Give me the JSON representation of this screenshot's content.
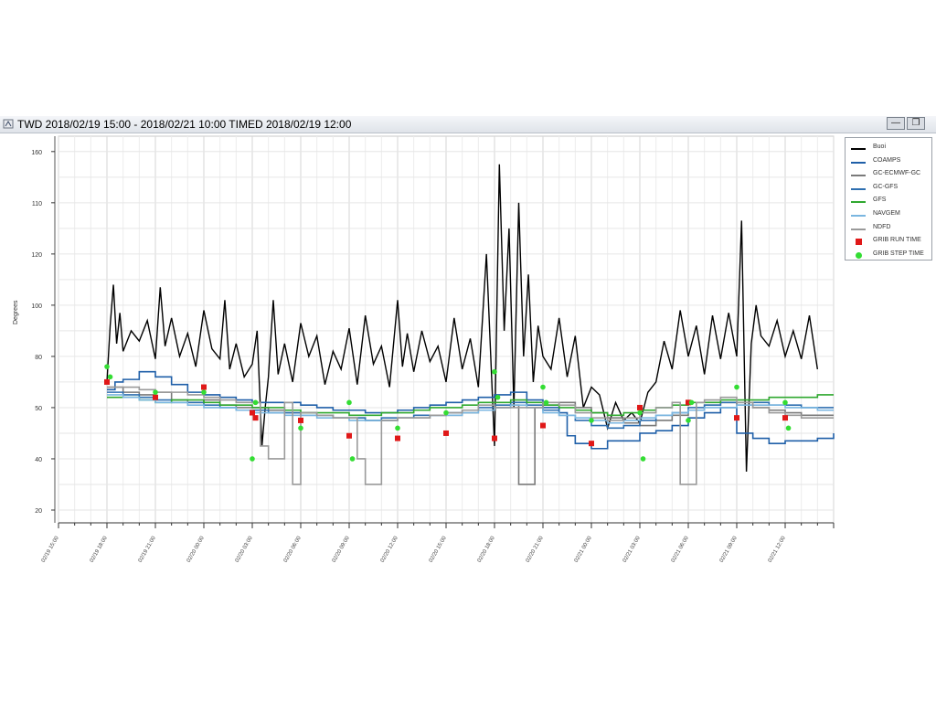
{
  "window": {
    "title": "TWD 2018/02/19 15:00 - 2018/02/21 10:00 TIMED 2018/02/19 12:00",
    "icon": "java-app-icon",
    "min_label": "—",
    "max_label": "❐"
  },
  "chart_data": {
    "type": "line",
    "ylabel": "Degrees",
    "ylim": [
      15,
      166
    ],
    "y_ticks": [
      20,
      40,
      60,
      80,
      100,
      120,
      140,
      160
    ],
    "y_tick_labels": [
      "20",
      "40",
      "50",
      "80",
      "100",
      "120",
      "110",
      "160"
    ],
    "x_tick_labels": [
      "02/19 15:00",
      "02/19 18:00",
      "02/19 21:00",
      "02/20 00:00",
      "02/20 03:00",
      "02/20 06:00",
      "02/20 09:00",
      "02/20 12:00",
      "02/20 15:00",
      "02/20 18:00",
      "02/20 21:00",
      "02/21 00:00",
      "02/21 03:00",
      "02/21 06:00",
      "02/21 09:00",
      "02/21 12:00"
    ],
    "x_range_hours": [
      0,
      48
    ],
    "series": [
      {
        "name": "Buoi",
        "color": "#000000",
        "style": "line",
        "x": [
          3.0,
          3.2,
          3.4,
          3.6,
          3.8,
          4.0,
          4.5,
          5.0,
          5.5,
          6.0,
          6.3,
          6.6,
          7.0,
          7.5,
          8.0,
          8.5,
          9.0,
          9.5,
          10.0,
          10.3,
          10.6,
          11.0,
          11.5,
          12.0,
          12.3,
          12.6,
          12.8,
          13.0,
          13.3,
          13.6,
          14.0,
          14.5,
          15.0,
          15.5,
          16.0,
          16.5,
          17.0,
          17.5,
          18.0,
          18.5,
          19.0,
          19.5,
          20.0,
          20.5,
          21.0,
          21.3,
          21.6,
          22.0,
          22.5,
          23.0,
          23.5,
          24.0,
          24.5,
          25.0,
          25.5,
          26.0,
          26.5,
          27.0,
          27.3,
          27.6,
          27.9,
          28.2,
          28.5,
          28.8,
          29.1,
          29.4,
          29.7,
          30.0,
          30.5,
          31.0,
          31.5,
          32.0,
          32.5,
          33.0,
          33.5,
          34.0,
          34.5,
          35.0,
          35.5,
          36.0,
          36.5,
          37.0,
          37.5,
          38.0,
          38.5,
          39.0,
          39.5,
          40.0,
          40.5,
          41.0,
          41.5,
          42.0,
          42.3,
          42.6,
          42.9,
          43.2,
          43.5,
          44.0,
          44.5,
          45.0,
          45.5,
          46.0,
          46.5,
          47.0
        ],
        "values": [
          70,
          92,
          108,
          85,
          97,
          82,
          90,
          86,
          94,
          79,
          107,
          84,
          95,
          80,
          89,
          76,
          98,
          83,
          79,
          102,
          75,
          85,
          72,
          77,
          90,
          45,
          60,
          72,
          102,
          73,
          85,
          70,
          93,
          80,
          88,
          69,
          82,
          75,
          91,
          69,
          96,
          77,
          84,
          68,
          102,
          76,
          89,
          74,
          90,
          78,
          84,
          70,
          95,
          75,
          87,
          68,
          120,
          45,
          155,
          90,
          130,
          60,
          140,
          80,
          112,
          70,
          92,
          80,
          75,
          95,
          72,
          88,
          60,
          68,
          65,
          52,
          62,
          55,
          58,
          54,
          66,
          70,
          86,
          75,
          98,
          80,
          92,
          73,
          96,
          79,
          97,
          80,
          133,
          35,
          85,
          100,
          88,
          84,
          94,
          80,
          90,
          79,
          96,
          75
        ]
      },
      {
        "name": "COAMPS",
        "color": "#1f5fa8",
        "style": "line",
        "x": [
          3,
          3.5,
          4,
          5,
          6,
          7,
          8,
          9,
          10,
          11,
          12,
          13,
          14,
          15,
          16,
          17,
          18,
          19,
          20,
          21,
          22,
          23,
          24,
          25,
          26,
          27,
          28,
          29,
          30,
          31,
          31.5,
          32,
          33,
          34,
          35,
          36,
          37,
          38,
          39,
          40,
          41,
          42,
          43,
          44,
          45,
          46,
          47,
          48
        ],
        "values": [
          67,
          70,
          71,
          74,
          72,
          69,
          66,
          65,
          64,
          63,
          62,
          62,
          62,
          61,
          60,
          59,
          59,
          58,
          58,
          59,
          60,
          61,
          62,
          63,
          64,
          65,
          66,
          63,
          60,
          58,
          49,
          46,
          44,
          47,
          47,
          50,
          51,
          53,
          56,
          58,
          60,
          50,
          48,
          46,
          47,
          47,
          48,
          50
        ]
      },
      {
        "name": "GC-ECMWF-GC",
        "color": "#7a7a7a",
        "style": "line",
        "x": [
          3,
          4,
          5,
          6,
          7,
          8,
          9,
          10,
          11,
          12,
          13,
          14,
          15,
          16,
          17,
          18,
          19,
          20,
          21,
          22,
          23,
          24,
          25,
          26,
          27,
          28,
          28.5,
          29,
          29.5,
          30,
          31,
          32,
          33,
          34,
          35,
          36,
          37,
          38,
          39,
          40,
          41,
          42,
          43,
          44,
          45,
          46,
          47,
          48
        ],
        "values": [
          68,
          66,
          65,
          66,
          63,
          62,
          63,
          61,
          60,
          60,
          59,
          58,
          58,
          57,
          56,
          56,
          55,
          55,
          56,
          56,
          57,
          57,
          58,
          59,
          60,
          61,
          30,
          30,
          60,
          61,
          62,
          60,
          58,
          56,
          54,
          53,
          55,
          57,
          59,
          61,
          62,
          61,
          60,
          59,
          58,
          57,
          57,
          57
        ]
      },
      {
        "name": "GC-GFS",
        "color": "#2e6fb0",
        "style": "line",
        "x": [
          3,
          4,
          5,
          6,
          7,
          8,
          9,
          10,
          11,
          12,
          13,
          14,
          15,
          16,
          17,
          18,
          19,
          20,
          21,
          22,
          23,
          24,
          25,
          26,
          27,
          28,
          29,
          30,
          31,
          32,
          33,
          34,
          35,
          36,
          37,
          38,
          39,
          40,
          41,
          42,
          43,
          44,
          45,
          46,
          47,
          48
        ],
        "values": [
          66,
          65,
          64,
          63,
          62,
          62,
          61,
          60,
          59,
          59,
          58,
          58,
          57,
          57,
          56,
          56,
          55,
          56,
          56,
          57,
          57,
          58,
          59,
          60,
          61,
          62,
          61,
          59,
          57,
          55,
          53,
          52,
          53,
          55,
          57,
          58,
          60,
          61,
          62,
          62,
          62,
          61,
          61,
          60,
          60,
          60
        ]
      },
      {
        "name": "GFS",
        "color": "#2fa82f",
        "style": "line",
        "x": [
          3,
          4,
          5,
          6,
          7,
          8,
          9,
          10,
          11,
          12,
          13,
          14,
          15,
          16,
          17,
          18,
          19,
          20,
          21,
          22,
          23,
          24,
          25,
          26,
          27,
          28,
          29,
          30,
          31,
          32,
          33,
          34,
          35,
          36,
          37,
          38,
          39,
          40,
          41,
          42,
          43,
          44,
          45,
          46,
          47,
          48
        ],
        "values": [
          64,
          64,
          63,
          62,
          63,
          63,
          62,
          61,
          61,
          60,
          60,
          59,
          58,
          58,
          58,
          57,
          57,
          58,
          58,
          59,
          60,
          60,
          61,
          62,
          62,
          63,
          62,
          61,
          60,
          59,
          58,
          57,
          58,
          59,
          60,
          61,
          62,
          62,
          63,
          63,
          63,
          64,
          64,
          64,
          65,
          65
        ]
      },
      {
        "name": "NAVGEM",
        "color": "#7ab6e0",
        "style": "line",
        "x": [
          3,
          4,
          5,
          6,
          7,
          8,
          9,
          10,
          11,
          12,
          13,
          14,
          15,
          16,
          17,
          18,
          19,
          20,
          21,
          22,
          23,
          24,
          25,
          26,
          27,
          28,
          29,
          30,
          31,
          32,
          33,
          34,
          35,
          36,
          37,
          38,
          39,
          40,
          41,
          42,
          43,
          44,
          45,
          46,
          47,
          48
        ],
        "values": [
          65,
          64,
          63,
          62,
          62,
          61,
          60,
          60,
          59,
          58,
          58,
          57,
          57,
          56,
          56,
          55,
          55,
          55,
          56,
          56,
          57,
          57,
          58,
          59,
          60,
          61,
          60,
          58,
          57,
          56,
          55,
          54,
          55,
          56,
          57,
          58,
          59,
          60,
          60,
          61,
          61,
          61,
          60,
          60,
          59,
          59
        ]
      },
      {
        "name": "NDFD",
        "color": "#9a9a9a",
        "style": "line",
        "x": [
          3,
          4,
          5,
          6,
          7,
          8,
          9,
          10,
          11,
          12,
          12.5,
          13,
          13.5,
          14,
          14.5,
          15,
          16,
          17,
          18,
          18.5,
          19,
          19.5,
          20,
          21,
          22,
          23,
          24,
          25,
          26,
          27,
          28,
          29,
          30,
          31,
          32,
          33,
          34,
          35,
          36,
          37,
          38,
          38.5,
          39,
          39.5,
          40,
          41,
          42,
          43,
          44,
          45,
          46,
          47,
          48
        ],
        "values": [
          68,
          68,
          67,
          66,
          66,
          65,
          64,
          63,
          62,
          62,
          45,
          40,
          40,
          62,
          30,
          58,
          57,
          56,
          56,
          40,
          30,
          30,
          55,
          56,
          56,
          57,
          58,
          59,
          61,
          60,
          60,
          60,
          62,
          61,
          58,
          56,
          55,
          56,
          58,
          60,
          62,
          30,
          30,
          62,
          63,
          64,
          62,
          60,
          58,
          57,
          56,
          56,
          56
        ]
      },
      {
        "name": "GRIB RUN TIME",
        "color": "#e01818",
        "style": "square",
        "x": [
          3,
          6,
          9,
          12,
          12.2,
          15,
          18,
          21,
          24,
          27,
          30,
          33,
          36,
          39,
          42,
          45
        ],
        "values": [
          70,
          64,
          68,
          58,
          56,
          55,
          49,
          48,
          50,
          48,
          53,
          46,
          60,
          62,
          56,
          56
        ]
      },
      {
        "name": "GRIB STEP TIME",
        "color": "#33dd33",
        "style": "circle",
        "x": [
          3,
          3.2,
          6,
          9,
          12,
          12.2,
          15,
          18,
          18.2,
          21,
          24,
          27,
          27.2,
          30,
          30.2,
          33,
          36,
          36.2,
          39,
          39.2,
          42,
          45,
          45.2
        ],
        "values": [
          76,
          72,
          66,
          66,
          40,
          62,
          52,
          62,
          40,
          52,
          58,
          74,
          64,
          68,
          62,
          55,
          58,
          40,
          55,
          62,
          68,
          62,
          52
        ]
      }
    ]
  }
}
